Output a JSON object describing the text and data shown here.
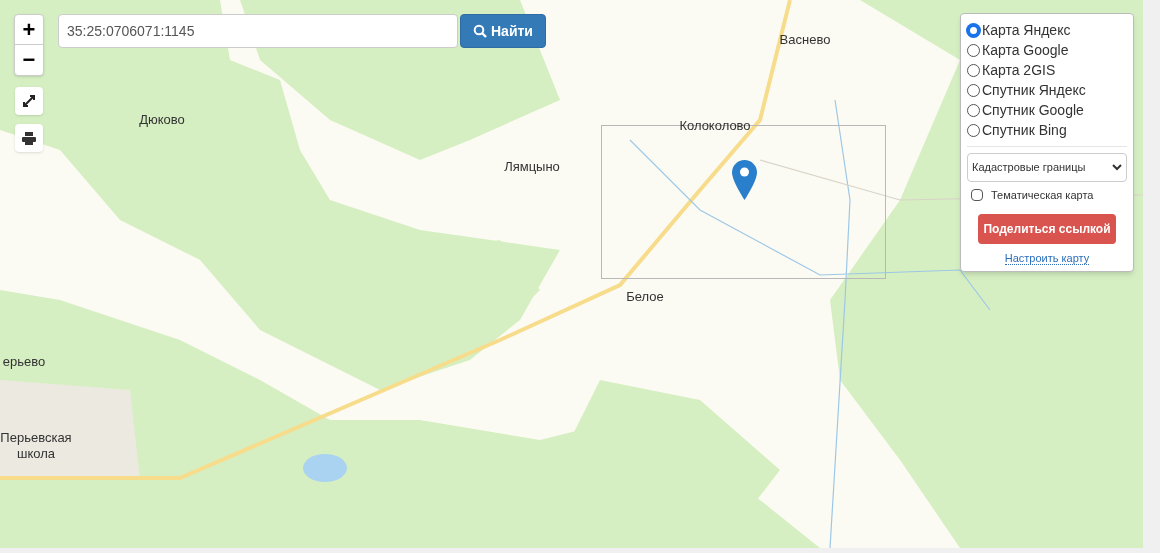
{
  "search": {
    "value": "35:25:0706071:1145",
    "button": "Найти"
  },
  "zoom": {
    "plus": "+",
    "minus": "−"
  },
  "map_labels": [
    {
      "text": "Васнево"
    },
    {
      "text": "Дюково"
    },
    {
      "text": "Колоколово"
    },
    {
      "text": "Лямцыно"
    },
    {
      "text": "Белое"
    },
    {
      "text": "ерьево"
    },
    {
      "text": "Перьевская школа"
    }
  ],
  "layers": [
    {
      "label": "Карта Яндекс",
      "selected": true
    },
    {
      "label": "Карта Google",
      "selected": false
    },
    {
      "label": "Карта 2GIS",
      "selected": false
    },
    {
      "label": "Спутник Яндекс",
      "selected": false
    },
    {
      "label": "Спутник Google",
      "selected": false
    },
    {
      "label": "Спутник Bing",
      "selected": false
    }
  ],
  "overlay_select": "Кадастровые границы",
  "thematic": {
    "label": "Тематическая карта",
    "checked": false
  },
  "share_button": "Поделиться ссылкой",
  "settings_link": "Настроить карту"
}
